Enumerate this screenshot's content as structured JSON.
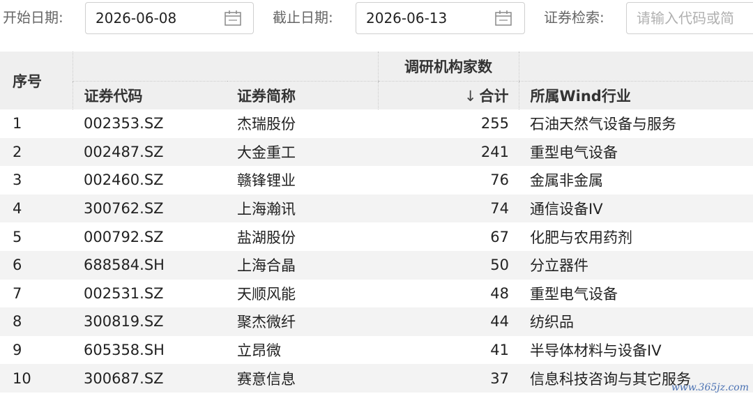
{
  "filters": {
    "start_label": "开始日期:",
    "start_value": "2026-06-08",
    "end_label": "截止日期:",
    "end_value": "2026-06-13",
    "search_label": "证券检索:",
    "search_placeholder": "请输入代码或简"
  },
  "table": {
    "col_index": "序号",
    "group_header": "调研机构家数",
    "col_code": "证券代码",
    "col_name": "证券简称",
    "sort_arrow": "↓",
    "col_total": "合计",
    "col_industry": "所属Wind行业",
    "rows": [
      {
        "idx": "1",
        "code": "002353.SZ",
        "name": "杰瑞股份",
        "total": "255",
        "industry": "石油天然气设备与服务"
      },
      {
        "idx": "2",
        "code": "002487.SZ",
        "name": "大金重工",
        "total": "241",
        "industry": "重型电气设备"
      },
      {
        "idx": "3",
        "code": "002460.SZ",
        "name": "赣锋锂业",
        "total": "76",
        "industry": "金属非金属"
      },
      {
        "idx": "4",
        "code": "300762.SZ",
        "name": "上海瀚讯",
        "total": "74",
        "industry": "通信设备IV"
      },
      {
        "idx": "5",
        "code": "000792.SZ",
        "name": "盐湖股份",
        "total": "67",
        "industry": "化肥与农用药剂"
      },
      {
        "idx": "6",
        "code": "688584.SH",
        "name": "上海合晶",
        "total": "50",
        "industry": "分立器件"
      },
      {
        "idx": "7",
        "code": "002531.SZ",
        "name": "天顺风能",
        "total": "48",
        "industry": "重型电气设备"
      },
      {
        "idx": "8",
        "code": "300819.SZ",
        "name": "聚杰微纤",
        "total": "44",
        "industry": "纺织品"
      },
      {
        "idx": "9",
        "code": "605358.SH",
        "name": "立昂微",
        "total": "41",
        "industry": "半导体材料与设备IV"
      },
      {
        "idx": "10",
        "code": "300687.SZ",
        "name": "赛意信息",
        "total": "37",
        "industry": "信息科技咨询与其它服务"
      }
    ]
  },
  "watermark": "www.365jz.com",
  "icons": {
    "calendar": "calendar-icon"
  },
  "colors": {
    "header_bg": "#efefef",
    "stripe_bg": "#f3f3f3",
    "watermark": "#2d5ba8"
  }
}
